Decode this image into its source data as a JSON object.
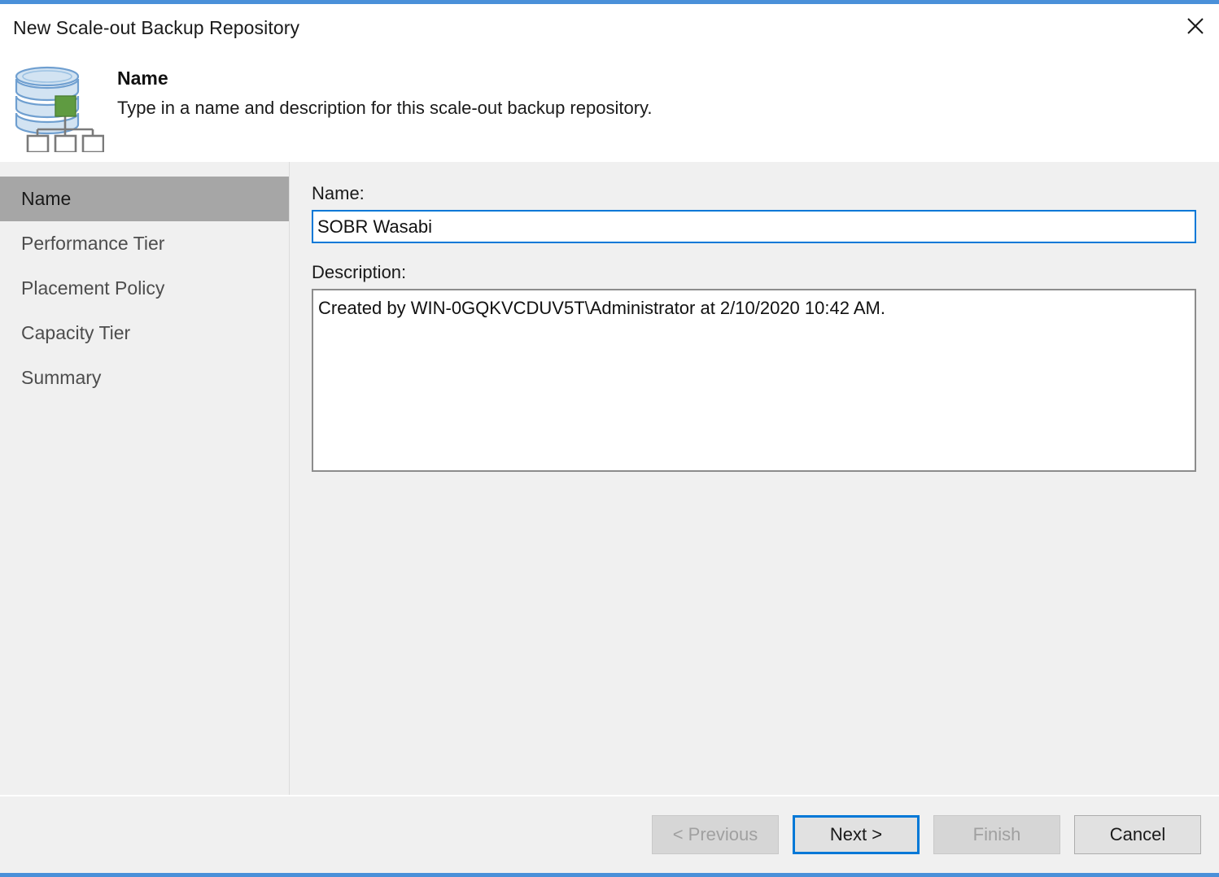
{
  "window": {
    "title": "New Scale-out Backup Repository",
    "accent_color": "#4a90d9",
    "close_icon": "close-icon"
  },
  "header": {
    "icon": "scale-out-backup-repository-icon",
    "title": "Name",
    "subtitle": "Type in a name and description for this scale-out backup repository."
  },
  "sidebar": {
    "items": [
      {
        "label": "Name",
        "selected": true
      },
      {
        "label": "Performance Tier",
        "selected": false
      },
      {
        "label": "Placement Policy",
        "selected": false
      },
      {
        "label": "Capacity Tier",
        "selected": false
      },
      {
        "label": "Summary",
        "selected": false
      }
    ],
    "selected_background": "#a6a6a6"
  },
  "form": {
    "name_label": "Name:",
    "name_value": "SOBR Wasabi",
    "name_placeholder": "",
    "name_focus_color": "#0078d7",
    "description_label": "Description:",
    "description_value": "Created by WIN-0GQKVCDUV5T\\Administrator at 2/10/2020 10:42 AM.",
    "description_placeholder": ""
  },
  "footer": {
    "buttons": [
      {
        "label": "< Previous",
        "state": "disabled"
      },
      {
        "label": "Next >",
        "state": "focused"
      },
      {
        "label": "Finish",
        "state": "disabled"
      },
      {
        "label": "Cancel",
        "state": "enabled"
      }
    ]
  }
}
